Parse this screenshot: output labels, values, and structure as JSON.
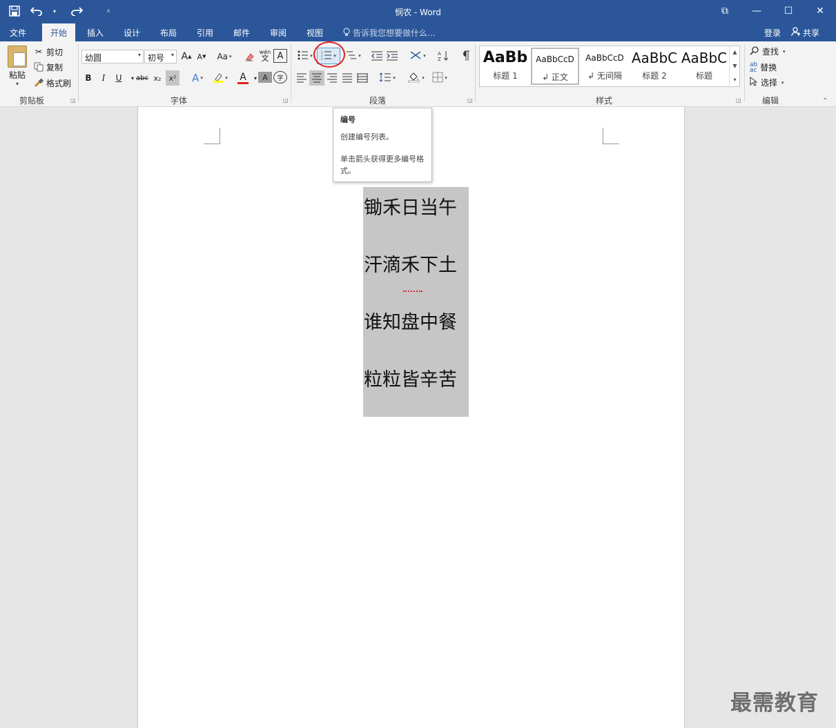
{
  "window": {
    "title": "悯农 - Word",
    "minimize": "—",
    "maximize": "☐",
    "close": "✕",
    "restore_ribbon": "⧉"
  },
  "qat": {
    "save_icon": "save-icon",
    "undo_icon": "undo-icon",
    "redo_icon": "redo-icon",
    "customize_icon": "customize-icon"
  },
  "tabs": [
    "文件",
    "开始",
    "插入",
    "设计",
    "布局",
    "引用",
    "邮件",
    "审阅",
    "视图"
  ],
  "active_tab": "开始",
  "tell_me": "告诉我您想要做什么...",
  "login": "登录",
  "share": "共享",
  "clipboard": {
    "paste": "粘贴",
    "cut": "剪切",
    "copy": "复制",
    "format_painter": "格式刷",
    "group_label": "剪贴板"
  },
  "font": {
    "font_name": "幼圆",
    "font_size": "初号",
    "grow": "A",
    "shrink": "A",
    "change_case": "Aa",
    "bold": "B",
    "italic": "I",
    "underline": "U",
    "strikethrough": "abc",
    "subscript": "x₂",
    "superscript": "x²",
    "phonetic": "wén",
    "phonetic_sub": "文",
    "char_border": "A",
    "text_effects": "A",
    "font_color": "A",
    "char_shading": "A",
    "enclose": "字",
    "group_label": "字体"
  },
  "paragraph": {
    "group_label": "段落"
  },
  "styles": {
    "items": [
      {
        "preview": "AaBb",
        "name": "标题 1"
      },
      {
        "preview": "AaBbCcD",
        "name": "↲ 正文"
      },
      {
        "preview": "AaBbCcD",
        "name": "↲ 无间隔"
      },
      {
        "preview": "AaBbC",
        "name": "标题 2"
      },
      {
        "preview": "AaBbC",
        "name": "标题"
      }
    ],
    "group_label": "样式"
  },
  "editing": {
    "find": "查找",
    "replace": "替换",
    "select": "选择",
    "group_label": "编辑"
  },
  "document": {
    "title_fragment": "农",
    "lines": [
      "锄禾日当午",
      "汗滴禾下土",
      "谁知盘中餐",
      "粒粒皆辛苦"
    ]
  },
  "tooltip": {
    "title": "编号",
    "description": "创建编号列表。",
    "more": "单击箭头获得更多编号格式。"
  },
  "watermark": "最需教育",
  "colors": {
    "brand_blue": "#2b579a",
    "title_red": "#e02020"
  }
}
